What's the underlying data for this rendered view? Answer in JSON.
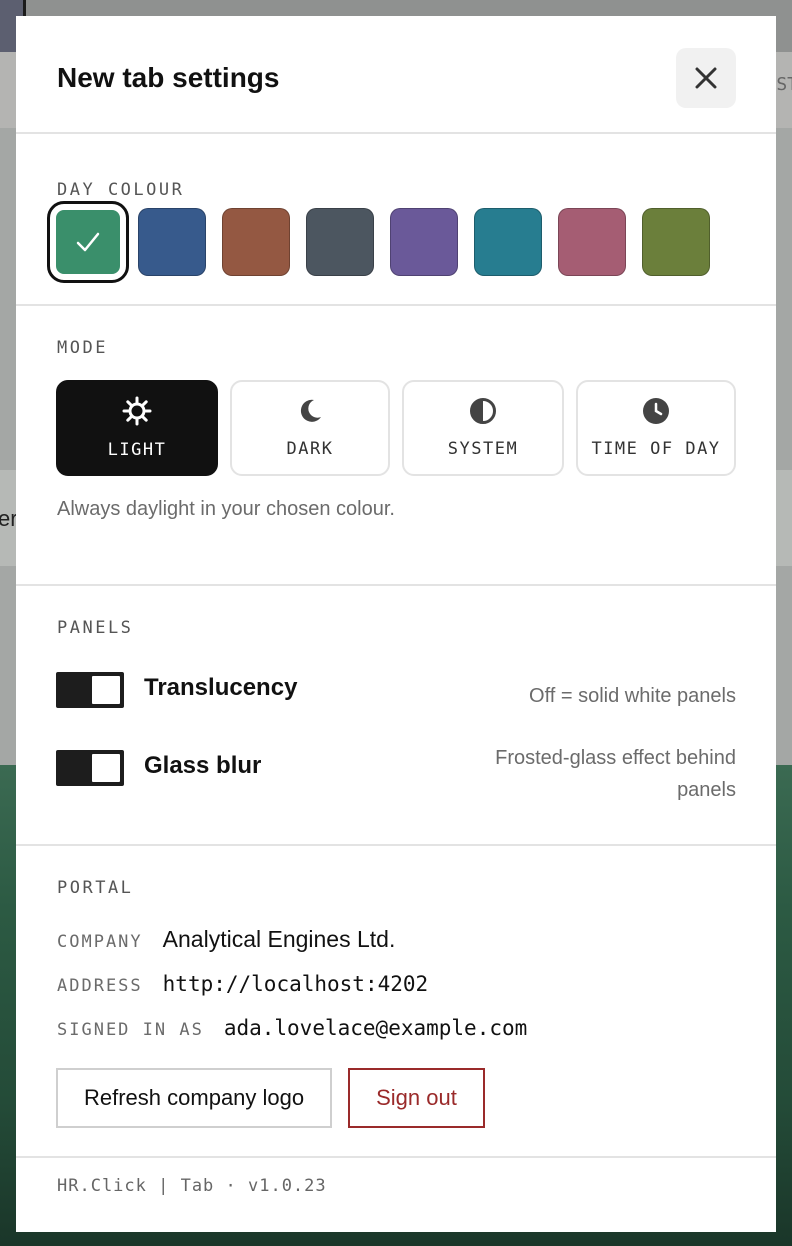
{
  "modal": {
    "title": "New tab settings"
  },
  "day_colour": {
    "label": "DAY COLOUR",
    "swatches": [
      {
        "color": "#3a8f6b",
        "selected": true
      },
      {
        "color": "#375a8c"
      },
      {
        "color": "#945842"
      },
      {
        "color": "#4c5660"
      },
      {
        "color": "#6a5999"
      },
      {
        "color": "#277d90"
      },
      {
        "color": "#a55d73"
      },
      {
        "color": "#6b7f3b"
      }
    ]
  },
  "mode": {
    "label": "MODE",
    "options": [
      {
        "label": "LIGHT",
        "icon": "sun-icon",
        "active": true
      },
      {
        "label": "DARK",
        "icon": "moon-icon"
      },
      {
        "label": "SYSTEM",
        "icon": "half-circle-icon"
      },
      {
        "label": "TIME OF DAY",
        "icon": "clock-icon"
      }
    ],
    "hint": "Always daylight in your chosen colour."
  },
  "panels": {
    "label": "PANELS",
    "translucency": {
      "label": "Translucency",
      "hint": "Off = solid white panels"
    },
    "glass_blur": {
      "label": "Glass blur",
      "hint_line1": "Frosted-glass effect behind",
      "hint_line2": "panels"
    }
  },
  "portal": {
    "label": "PORTAL",
    "company_key": "COMPANY",
    "company_value": "Analytical Engines Ltd.",
    "address_key": "ADDRESS",
    "address_value": "http://localhost:4202",
    "signed_in_key": "SIGNED IN AS",
    "signed_in_value": "ada.lovelace@example.com",
    "refresh_label": "Refresh company logo",
    "sign_out_label": "Sign out"
  },
  "footer": {
    "text": "HR.Click | Tab · v1.0.23"
  },
  "background": {
    "edge_text_left": "er",
    "edge_text_right": "ST"
  }
}
